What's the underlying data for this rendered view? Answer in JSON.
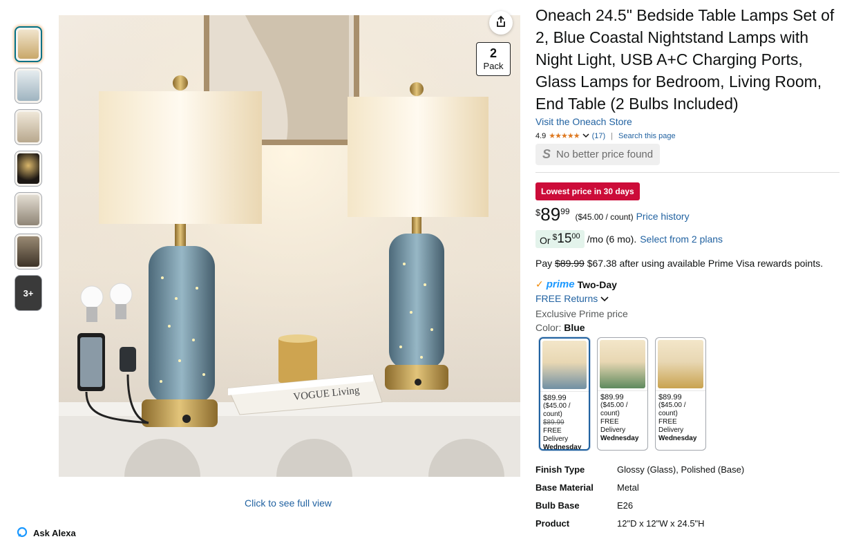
{
  "thumbnails": [
    {
      "tint": "#e9dcc6",
      "label": ""
    },
    {
      "tint": "#d5dfe4",
      "label": ""
    },
    {
      "tint": "#e4dccd",
      "label": ""
    },
    {
      "tint": "#2a2520",
      "label": ""
    },
    {
      "tint": "#d8d2c8",
      "label": ""
    },
    {
      "tint": "#5a4e40",
      "label": ""
    }
  ],
  "thumb_more": "3+",
  "image": {
    "pack_number": "2",
    "pack_label": "Pack",
    "book_text": "VOGUE Living",
    "full_view": "Click to see full view"
  },
  "alexa": "Ask Alexa",
  "product": {
    "title": "Oneach 24.5\" Bedside Table Lamps Set of 2, Blue Coastal Nightstand Lamps with Night Light, USB A+C Charging Ports, Glass Lamps for Bedroom, Living Room, End Table (2 Bulbs Included)",
    "store": "Visit the Oneach Store",
    "rating": "4.9",
    "stars": "★★★★★",
    "review_count": "(17)",
    "search_page": "Search this page",
    "no_better_price": "No better price found",
    "deal_badge": "Lowest price in 30 days",
    "price_symbol": "$",
    "price_whole": "89",
    "price_fraction": "99",
    "per_count": "($45.00 / count)",
    "price_history": "Price history",
    "installment_or": "Or",
    "installment_symbol": "$",
    "installment_whole": "15",
    "installment_fraction": "00",
    "installment_term": "/mo (6 mo).",
    "installment_link": "Select from 2 plans",
    "pay_prefix": "Pay",
    "pay_strike": "$89.99",
    "pay_rest": "$67.38 after using available Prime Visa rewards points.",
    "prime_word": "prime",
    "prime_speed": "Two-Day",
    "free_returns": "FREE Returns",
    "exclusive": "Exclusive Prime price",
    "color_label": "Color:",
    "color_value": "Blue"
  },
  "swatches": [
    {
      "price": "$89.99",
      "per": "($45.00 / count)",
      "strike": "$89.99",
      "delivery": "FREE Delivery",
      "day": "Wednesday",
      "accent": "#6f8fa3"
    },
    {
      "price": "$89.99",
      "per": "($45.00 / count)",
      "strike": "",
      "delivery": "FREE Delivery",
      "day": "Wednesday",
      "accent": "#5e8a5e"
    },
    {
      "price": "$89.99",
      "per": "($45.00 / count)",
      "strike": "",
      "delivery": "FREE Delivery",
      "day": "Wednesday",
      "accent": "#c9a34f"
    }
  ],
  "specs": [
    {
      "key": "Finish Type",
      "value": "Glossy (Glass), Polished (Base)"
    },
    {
      "key": "Base Material",
      "value": "Metal"
    },
    {
      "key": "Bulb Base",
      "value": "E26"
    },
    {
      "key": "Product",
      "value": "12\"D x 12\"W x 24.5\"H"
    }
  ],
  "colors": {
    "link": "#2162a1",
    "deal": "#cc0c39",
    "star": "#de7921",
    "prime": "#1a98ff"
  }
}
